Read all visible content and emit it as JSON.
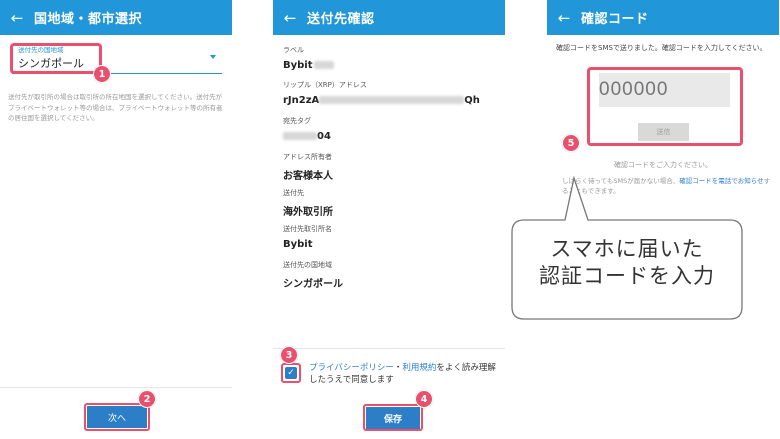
{
  "screens": {
    "region_select": {
      "back_icon": "arrow-left-icon",
      "title": "国地域・都市選択",
      "select_label": "送付先の国地域",
      "select_value": "シンガポール",
      "note": "送付先が取引所の場合は取引所の所在地国を選択してください。送付先がプライベートウォレット等の場合は、プライベートウォレット等の所有者の居住国を選択してください。",
      "next_button": "次へ"
    },
    "destination_confirm": {
      "title": "送付先確認",
      "fields": [
        {
          "label": "ラベル",
          "value_prefix": "Bybit",
          "value_suffix": ""
        },
        {
          "label": "リップル（XRP）アドレス",
          "value_prefix": "rJn2zA",
          "value_suffix": "Qh"
        },
        {
          "label": "宛先タグ",
          "value_prefix": "",
          "value_suffix": "04"
        },
        {
          "label": "アドレス所有者",
          "value_prefix": "お客様本人",
          "value_suffix": ""
        },
        {
          "label": "送付先",
          "value_prefix": "海外取引所",
          "value_suffix": ""
        },
        {
          "label": "送付先取引所名",
          "value_prefix": "Bybit",
          "value_suffix": ""
        },
        {
          "label": "送付先の国地域",
          "value_prefix": "シンガポール",
          "value_suffix": ""
        }
      ],
      "agree_link1": "プライバシーポリシー",
      "agree_sep": "・",
      "agree_link2": "利用規約",
      "agree_text": "をよく読み理解したうえで同意します",
      "save_button": "保存"
    },
    "verify_code": {
      "title": "確認コード",
      "message": "確認コードをSMSで送りました。確認コードを入力してください。",
      "code_placeholder": "000000",
      "send_button": "送信",
      "hint": "確認コードをご入力ください。",
      "resend_prefix": "しばらく待ってもSMSが届かない場合、",
      "resend_link": "確認コードを電話でお知らせ",
      "resend_suffix": "することもできます。"
    }
  },
  "markers": [
    "1",
    "2",
    "3",
    "4",
    "5"
  ],
  "callout": {
    "line1": "スマホに届いた",
    "line2": "認証コードを入力"
  },
  "colors": {
    "appbar": "#2196d8",
    "button": "#2c7fc7",
    "highlight": "#e8506e"
  }
}
